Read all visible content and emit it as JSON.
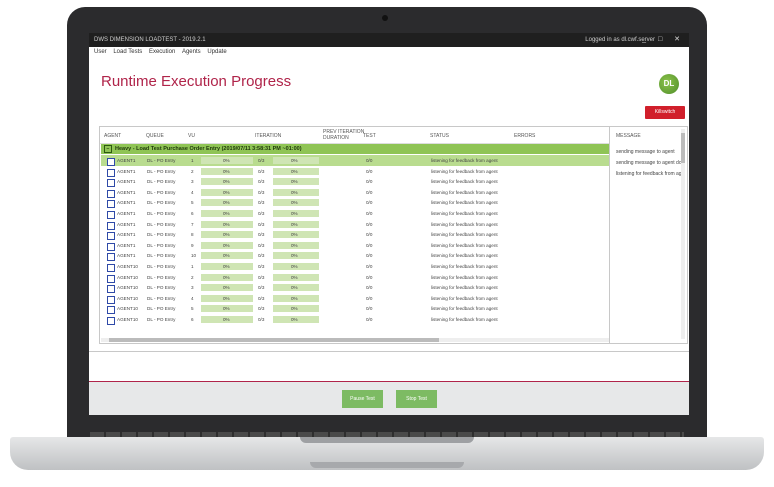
{
  "app": {
    "window_title": "DWS DIMENSION LOADTEST - 2019.2.1",
    "logged_in": "Logged in as dl.cwf.server",
    "window_controls": [
      "_",
      "□",
      "✕"
    ]
  },
  "menu": [
    "User",
    "Load Tests",
    "Execution",
    "Agents",
    "Update"
  ],
  "page_title": "Runtime Execution Progress",
  "logo_text": "DL",
  "killswitch_label": "Killswitch",
  "columns": [
    "AGENT",
    "QUEUE",
    "VU",
    "ITERATION",
    "PREV ITERATION DURATION",
    "TEST",
    "STATUS",
    "ERRORS"
  ],
  "columns_prev_line1": "PREV ITERATION",
  "columns_prev_line2": "DURATION",
  "group_label": "Heavy - Load Test Purchase Order Entry  (2019/07/11 3:58:31 PM ~01:00)",
  "rows": [
    {
      "agent": "AGENT1",
      "queue": "DL - PO Entry",
      "vu": "1",
      "vu_pct": "0%",
      "iter": "0/3",
      "iter_pct": "0%",
      "test": "0/0",
      "status": "listening for feedback from agent"
    },
    {
      "agent": "AGENT1",
      "queue": "DL - PO Entry",
      "vu": "2",
      "vu_pct": "0%",
      "iter": "0/3",
      "iter_pct": "0%",
      "test": "0/0",
      "status": "listening for feedback from agent"
    },
    {
      "agent": "AGENT1",
      "queue": "DL - PO Entry",
      "vu": "3",
      "vu_pct": "0%",
      "iter": "0/3",
      "iter_pct": "0%",
      "test": "0/0",
      "status": "listening for feedback from agent"
    },
    {
      "agent": "AGENT1",
      "queue": "DL - PO Entry",
      "vu": "4",
      "vu_pct": "0%",
      "iter": "0/3",
      "iter_pct": "0%",
      "test": "0/0",
      "status": "listening for feedback from agent"
    },
    {
      "agent": "AGENT1",
      "queue": "DL - PO Entry",
      "vu": "5",
      "vu_pct": "0%",
      "iter": "0/3",
      "iter_pct": "0%",
      "test": "0/0",
      "status": "listening for feedback from agent"
    },
    {
      "agent": "AGENT1",
      "queue": "DL - PO Entry",
      "vu": "6",
      "vu_pct": "0%",
      "iter": "0/3",
      "iter_pct": "0%",
      "test": "0/0",
      "status": "listening for feedback from agent"
    },
    {
      "agent": "AGENT1",
      "queue": "DL - PO Entry",
      "vu": "7",
      "vu_pct": "0%",
      "iter": "0/3",
      "iter_pct": "0%",
      "test": "0/0",
      "status": "listening for feedback from agent"
    },
    {
      "agent": "AGENT1",
      "queue": "DL - PO Entry",
      "vu": "8",
      "vu_pct": "0%",
      "iter": "0/3",
      "iter_pct": "0%",
      "test": "0/0",
      "status": "listening for feedback from agent"
    },
    {
      "agent": "AGENT1",
      "queue": "DL - PO Entry",
      "vu": "9",
      "vu_pct": "0%",
      "iter": "0/3",
      "iter_pct": "0%",
      "test": "0/0",
      "status": "listening for feedback from agent"
    },
    {
      "agent": "AGENT1",
      "queue": "DL - PO Entry",
      "vu": "10",
      "vu_pct": "0%",
      "iter": "0/3",
      "iter_pct": "0%",
      "test": "0/0",
      "status": "listening for feedback from agent"
    },
    {
      "agent": "AGENT10",
      "queue": "DL - PO Entry",
      "vu": "1",
      "vu_pct": "0%",
      "iter": "0/3",
      "iter_pct": "0%",
      "test": "0/0",
      "status": "listening for feedback from agent"
    },
    {
      "agent": "AGENT10",
      "queue": "DL - PO Entry",
      "vu": "2",
      "vu_pct": "0%",
      "iter": "0/3",
      "iter_pct": "0%",
      "test": "0/0",
      "status": "listening for feedback from agent"
    },
    {
      "agent": "AGENT10",
      "queue": "DL - PO Entry",
      "vu": "3",
      "vu_pct": "0%",
      "iter": "0/3",
      "iter_pct": "0%",
      "test": "0/0",
      "status": "listening for feedback from agent"
    },
    {
      "agent": "AGENT10",
      "queue": "DL - PO Entry",
      "vu": "4",
      "vu_pct": "0%",
      "iter": "0/3",
      "iter_pct": "0%",
      "test": "0/0",
      "status": "listening for feedback from agent"
    },
    {
      "agent": "AGENT10",
      "queue": "DL - PO Entry",
      "vu": "5",
      "vu_pct": "0%",
      "iter": "0/3",
      "iter_pct": "0%",
      "test": "0/0",
      "status": "listening for feedback from agent"
    },
    {
      "agent": "AGENT10",
      "queue": "DL - PO Entry",
      "vu": "6",
      "vu_pct": "0%",
      "iter": "0/3",
      "iter_pct": "0%",
      "test": "0/0",
      "status": "listening for feedback from agent"
    }
  ],
  "message_panel": {
    "header": "MESSAGE",
    "messages": [
      "sending message to agent",
      "sending message to agent don",
      "listening for feedback from age"
    ]
  },
  "footer": {
    "pause_label": "Pause Test",
    "stop_label": "Stop Test"
  },
  "colors": {
    "accent": "#b0244a",
    "group": "#8fc455",
    "selected_row": "#b9dc8f",
    "killswitch": "#d11f2b",
    "button": "#7dbb63"
  },
  "icons": [
    "checkbox-icon",
    "expand-icon",
    "logo-icon"
  ]
}
